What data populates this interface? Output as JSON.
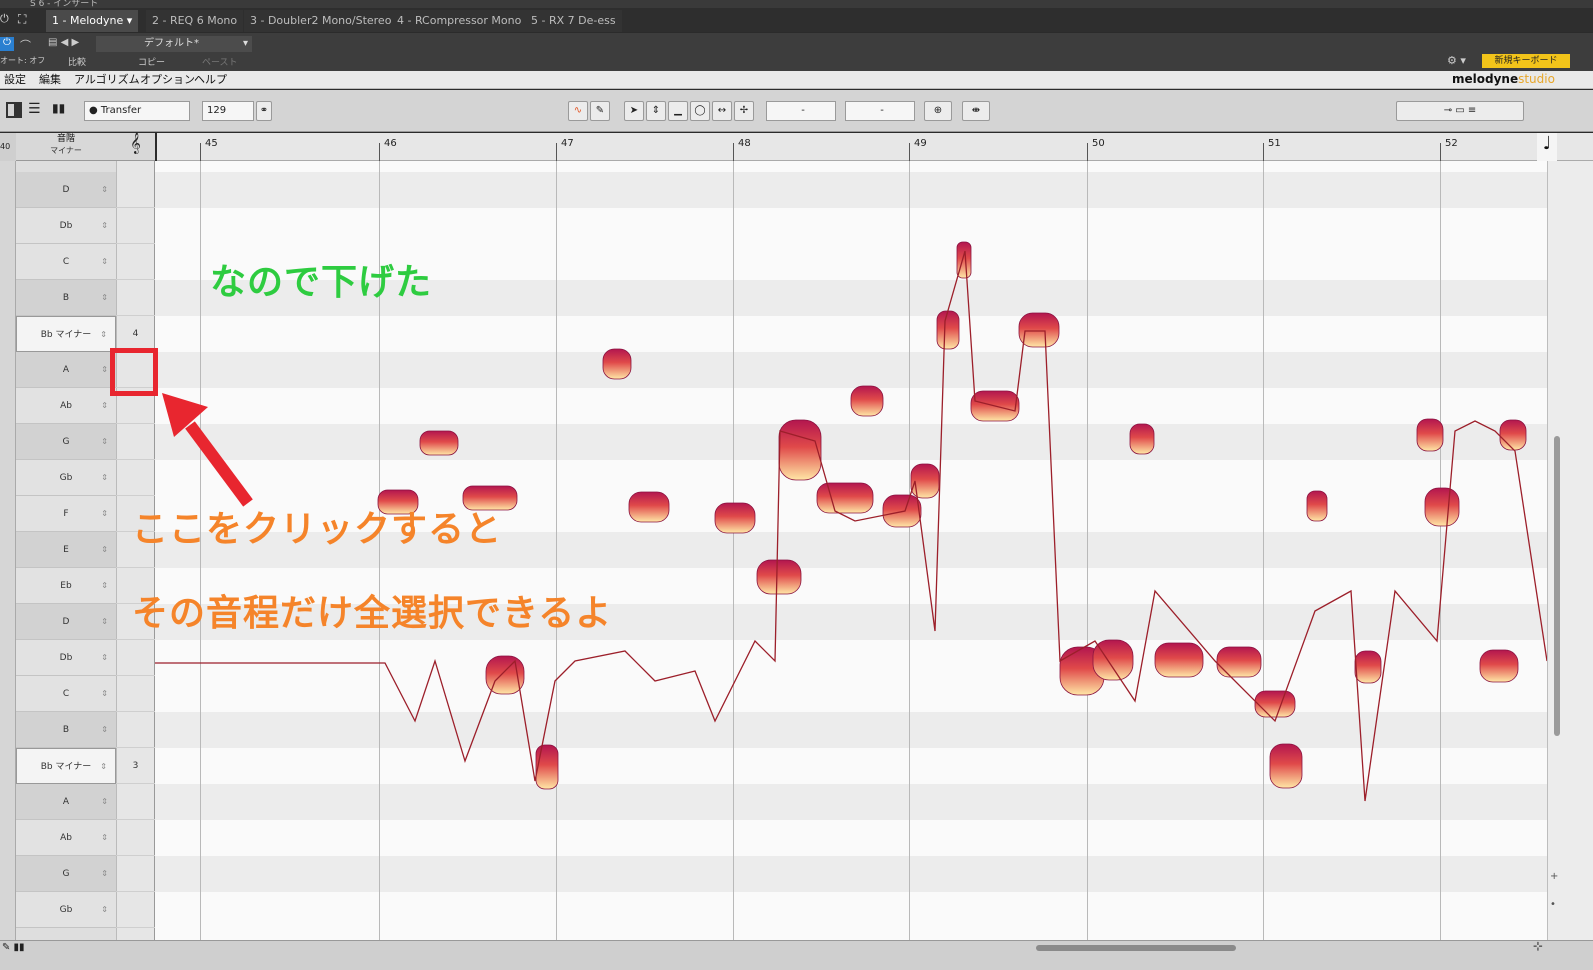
{
  "window": {
    "title": "S 6 - インサート"
  },
  "tabs": [
    "1 - Melodyne",
    "2 - REQ 6 Mono",
    "3 - Doubler2 Mono/Stereo",
    "4 - RCompressor Mono",
    "5 - RX 7 De-ess"
  ],
  "preset": {
    "name": "デフォルト*",
    "auto": "オート: オフ",
    "compare": "比較",
    "copy": "コピー",
    "paste": "ペースト",
    "new_keyboard": "新規キーボード"
  },
  "menu": [
    "設定",
    "編集",
    "アルゴリズム",
    "オプション",
    "ヘルプ"
  ],
  "brand": {
    "name": "melodyne",
    "edition": "studio"
  },
  "toolbar": {
    "transfer": "Transfer",
    "tempo": "129",
    "field1": "-",
    "field2": "-"
  },
  "ruler": {
    "bars": [
      "45",
      "46",
      "47",
      "48",
      "49",
      "50",
      "51",
      "52"
    ]
  },
  "scale": {
    "header": "音階",
    "mode": "マイナー",
    "left_value": "40"
  },
  "keys": [
    "D",
    "Db",
    "C",
    "B",
    "Bb マイナー",
    "A",
    "Ab",
    "G",
    "Gb",
    "F",
    "E",
    "Eb",
    "D",
    "Db",
    "C",
    "B",
    "Bb マイナー",
    "A",
    "Ab",
    "G",
    "Gb"
  ],
  "octaves": {
    "bb_upper": "4",
    "bb_lower": "3"
  },
  "annotations": {
    "top": "なので下げた",
    "line1": "ここをクリックすると",
    "line2": "その音程だけ全選択できるよ"
  },
  "colors": {
    "blob_dark": "#b3164f",
    "blob_light": "#ffe7a6",
    "annotation_green": "#2ecc40",
    "annotation_orange": "#f5842a",
    "highlight_red": "#e8262f"
  }
}
